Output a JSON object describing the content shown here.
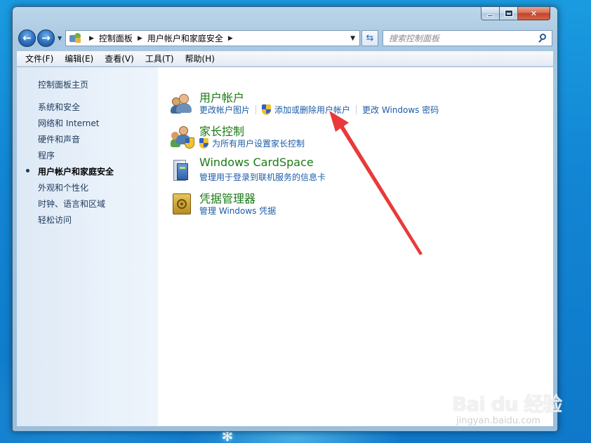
{
  "window": {
    "address": {
      "crumbs": [
        "控制面板",
        "用户帐户和家庭安全"
      ]
    },
    "search": {
      "placeholder": "搜索控制面板"
    },
    "menu": [
      "文件(F)",
      "编辑(E)",
      "查看(V)",
      "工具(T)",
      "帮助(H)"
    ]
  },
  "sidebar": {
    "home": "控制面板主页",
    "items": [
      {
        "label": "系统和安全",
        "active": false
      },
      {
        "label": "网络和 Internet",
        "active": false
      },
      {
        "label": "硬件和声音",
        "active": false
      },
      {
        "label": "程序",
        "active": false
      },
      {
        "label": "用户帐户和家庭安全",
        "active": true
      },
      {
        "label": "外观和个性化",
        "active": false
      },
      {
        "label": "时钟、语言和区域",
        "active": false
      },
      {
        "label": "轻松访问",
        "active": false
      }
    ]
  },
  "categories": [
    {
      "title": "用户帐户",
      "icon": "users-icon",
      "links": [
        {
          "label": "更改帐户图片",
          "shield": false
        },
        {
          "label": "添加或删除用户帐户",
          "shield": true
        },
        {
          "label": "更改 Windows 密码",
          "shield": false
        }
      ]
    },
    {
      "title": "家长控制",
      "icon": "family-safety-icon",
      "links": [
        {
          "label": "为所有用户设置家长控制",
          "shield": true
        }
      ]
    },
    {
      "title": "Windows CardSpace",
      "icon": "cardspace-icon",
      "links": [
        {
          "label": "管理用于登录到联机服务的信息卡",
          "shield": false
        }
      ]
    },
    {
      "title": "凭据管理器",
      "icon": "credential-vault-icon",
      "links": [
        {
          "label": "管理 Windows 凭据",
          "shield": false
        }
      ]
    }
  ],
  "annotation": {
    "color": "#e83a3a"
  },
  "watermark": {
    "main": "Bai du 经验",
    "sub": "jingyan.baidu.com"
  },
  "colors": {
    "category_title": "#1a7a14",
    "link": "#1b5ca8",
    "sidebar_text": "#1e395b",
    "desktop": "#1285d3",
    "close_button": "#c2442a"
  }
}
